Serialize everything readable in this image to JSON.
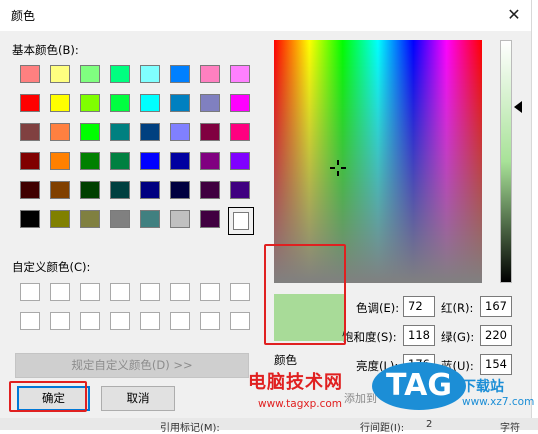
{
  "dialog": {
    "title": "颜色",
    "close_glyph": "✕",
    "basic_colors_label": "基本颜色(B):",
    "custom_colors_label": "自定义颜色(C):",
    "define_custom_button": "规定自定义颜色(D) >>",
    "ok_button": "确定",
    "cancel_button": "取消",
    "color_solid_label": "颜色",
    "add_to_custom_hint": "添加到",
    "fields": {
      "hue_label": "色调(E):",
      "hue": "72",
      "sat_label": "饱和度(S):",
      "sat": "118",
      "lum_label": "亮度(L):",
      "lum": "176",
      "red_label": "红(R):",
      "red": "167",
      "green_label": "绿(G):",
      "green": "220",
      "blue_label": "蓝(U):",
      "blue": "154"
    },
    "preview_color": "#a8db98",
    "basic_colors": [
      [
        "#ff8080",
        "#ffff80",
        "#80ff80",
        "#00ff80",
        "#80ffff",
        "#0080ff",
        "#ff80c0",
        "#ff80ff"
      ],
      [
        "#ff0000",
        "#ffff00",
        "#80ff00",
        "#00ff40",
        "#00ffff",
        "#0080c0",
        "#8080c0",
        "#ff00ff"
      ],
      [
        "#804040",
        "#ff8040",
        "#00ff00",
        "#008080",
        "#004080",
        "#8080ff",
        "#800040",
        "#ff0080"
      ],
      [
        "#800000",
        "#ff8000",
        "#008000",
        "#008040",
        "#0000ff",
        "#0000a0",
        "#800080",
        "#8000ff"
      ],
      [
        "#400000",
        "#804000",
        "#004000",
        "#004040",
        "#000080",
        "#000040",
        "#400040",
        "#400080"
      ],
      [
        "#000000",
        "#808000",
        "#808040",
        "#808080",
        "#408080",
        "#c0c0c0",
        "#400040",
        "#ffffff"
      ]
    ]
  },
  "watermark": {
    "cn_text": "电脑技术网",
    "url": "www.tagxp.com",
    "tag": "TAG",
    "site": "下载站",
    "site_url": "www.xz7.com"
  },
  "background_fragments": {
    "left_fragment": "引用标记(M):",
    "mid_fragment": "行间距(I):",
    "right_fragment": "字符",
    "num": "2"
  }
}
